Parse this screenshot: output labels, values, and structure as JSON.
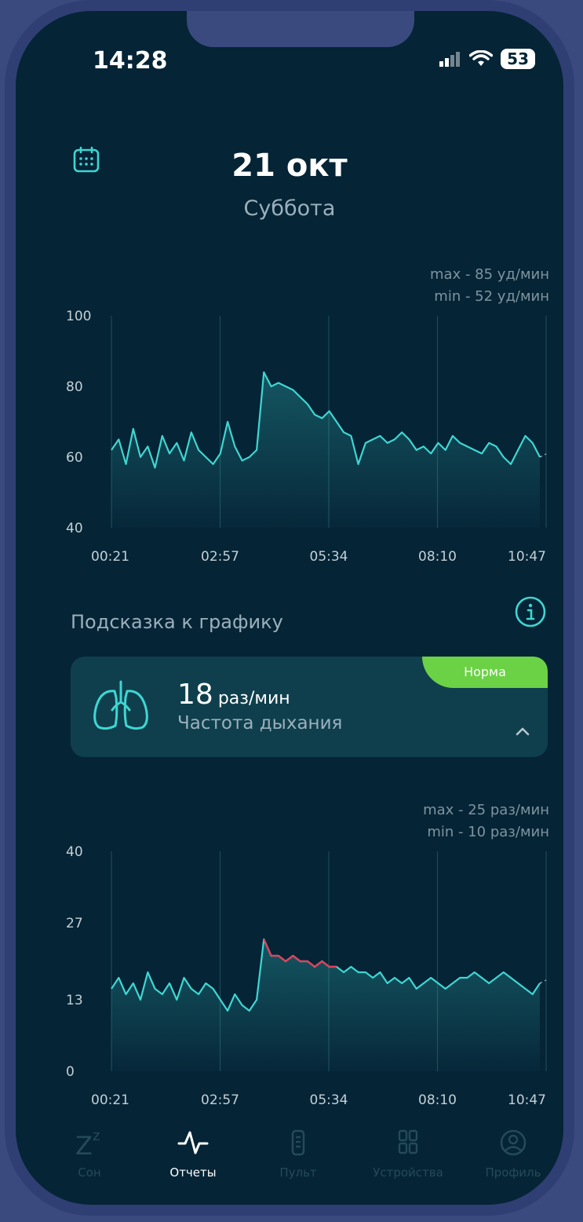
{
  "status": {
    "time": "14:28",
    "battery": "53"
  },
  "header": {
    "date": "21 окт",
    "day": "Суббота"
  },
  "heart": {
    "max_label": "max - 85 уд/мин",
    "min_label": "min - 52 уд/мин"
  },
  "hint": {
    "label": "Подсказка к графику"
  },
  "breath_card": {
    "value": "18",
    "unit": "раз/мин",
    "label": "Частота дыхания",
    "badge": "Норма"
  },
  "breath": {
    "max_label": "max - 25 раз/мин",
    "min_label": "min - 10 раз/мин"
  },
  "tabs": [
    {
      "label": "Сон",
      "icon": "zz-icon",
      "active": false
    },
    {
      "label": "Отчеты",
      "icon": "pulse-icon",
      "active": true
    },
    {
      "label": "Пульт",
      "icon": "remote-icon",
      "active": false
    },
    {
      "label": "Устройства",
      "icon": "grid-icon",
      "active": false
    },
    {
      "label": "Профиль",
      "icon": "user-icon",
      "active": false
    }
  ],
  "colors": {
    "background": "#052436",
    "line": "#3fd6d2",
    "alert": "#e0405a",
    "badge": "#6bd246"
  },
  "chart_data": [
    {
      "type": "line",
      "title": "",
      "xlabel": "",
      "ylabel": "",
      "x_ticks": [
        "00:21",
        "02:57",
        "05:34",
        "08:10",
        "10:47"
      ],
      "y_ticks": [
        "100",
        "80",
        "60",
        "40"
      ],
      "ylim": [
        40,
        100
      ],
      "grid": "vertical",
      "series": [
        {
          "values": [
            62,
            65,
            58,
            68,
            60,
            63,
            57,
            66,
            61,
            64,
            59,
            67,
            62,
            60,
            58,
            61,
            70,
            63,
            59,
            60,
            62,
            84,
            80,
            81,
            80,
            79,
            77,
            75,
            72,
            71,
            73,
            70,
            67,
            66,
            58,
            64,
            65,
            66,
            64,
            65,
            67,
            65,
            62,
            63,
            61,
            64,
            62,
            66,
            64,
            63,
            62,
            61,
            64,
            63,
            60,
            58,
            62,
            66,
            64,
            60
          ]
        }
      ]
    },
    {
      "type": "line",
      "title": "",
      "xlabel": "",
      "ylabel": "",
      "x_ticks": [
        "00:21",
        "02:57",
        "05:34",
        "08:10",
        "10:47"
      ],
      "y_ticks": [
        "40",
        "27",
        "13",
        "0"
      ],
      "ylim": [
        0,
        40
      ],
      "grid": "vertical",
      "series": [
        {
          "values": [
            15,
            17,
            14,
            16,
            13,
            18,
            15,
            14,
            16,
            13,
            17,
            15,
            14,
            16,
            15,
            13,
            11,
            14,
            12,
            11,
            13,
            24,
            21,
            21,
            20,
            21,
            20,
            20,
            19,
            20,
            19,
            19,
            18,
            19,
            18,
            18,
            17,
            18,
            16,
            17,
            16,
            17,
            15,
            16,
            17,
            16,
            15,
            16,
            17,
            17,
            18,
            17,
            16,
            17,
            18,
            17,
            16,
            15,
            14,
            16
          ]
        }
      ],
      "highlight_above": 19
    }
  ]
}
